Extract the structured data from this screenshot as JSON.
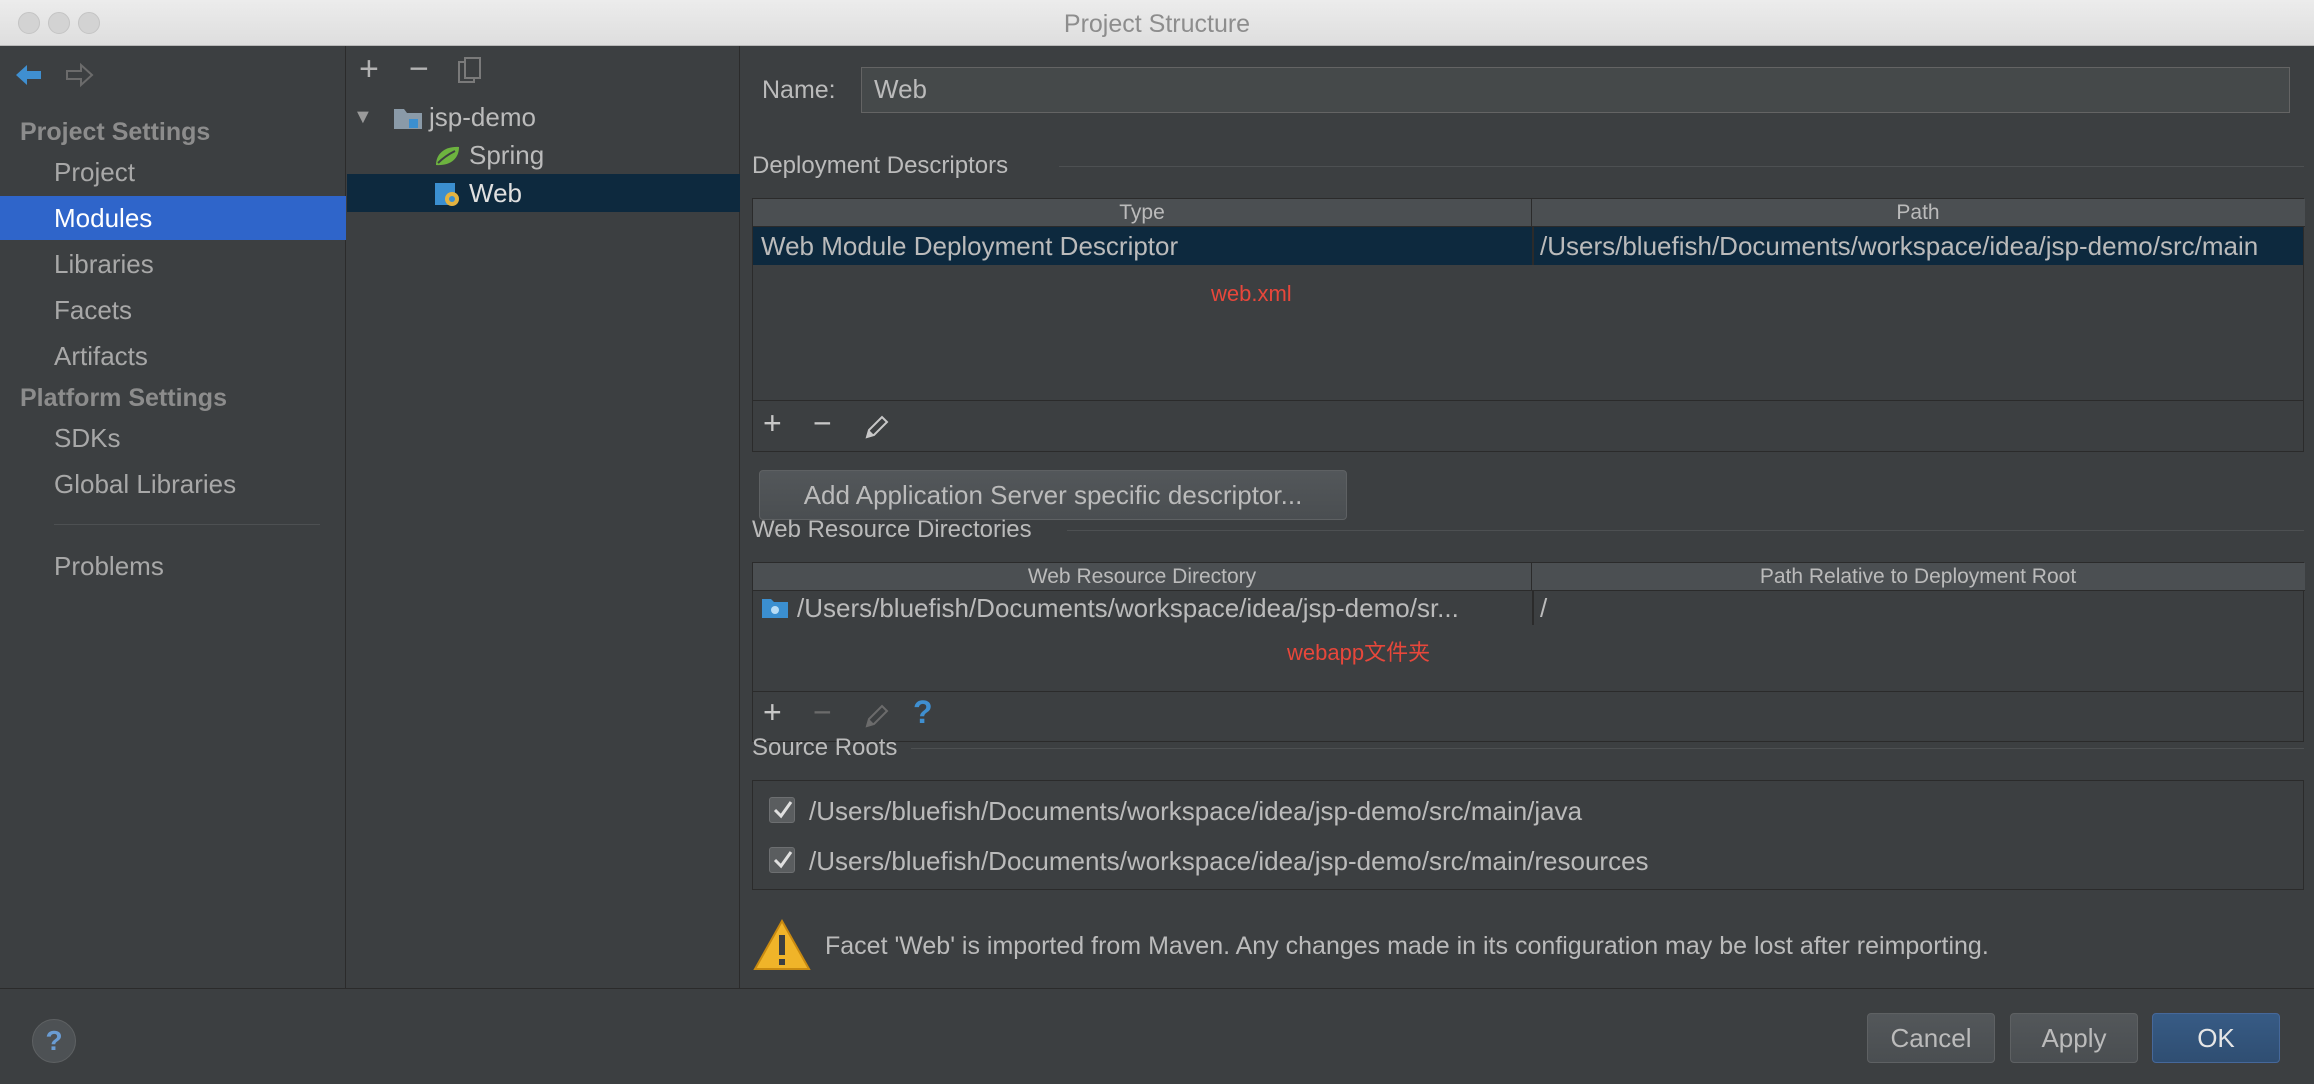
{
  "window": {
    "title": "Project Structure"
  },
  "nav": {
    "project_settings": "Project Settings",
    "project_items": [
      "Project",
      "Modules",
      "Libraries",
      "Facets",
      "Artifacts"
    ],
    "platform_settings": "Platform Settings",
    "platform_items": [
      "SDKs",
      "Global Libraries"
    ],
    "problems": "Problems",
    "selected": "Modules"
  },
  "tree": {
    "toolbar": {
      "add": "+",
      "remove": "−"
    },
    "nodes": [
      "jsp-demo",
      "Spring",
      "Web"
    ],
    "selected": "Web"
  },
  "form": {
    "name_label": "Name:",
    "name_value": "Web"
  },
  "deployment": {
    "title": "Deployment Descriptors",
    "columns": [
      "Type",
      "Path"
    ],
    "rows": [
      [
        "Web Module Deployment Descriptor",
        "/Users/bluefish/Documents/workspace/idea/jsp-demo/src/main"
      ]
    ],
    "annotation": "web.xml",
    "add_server_button": "Add Application Server specific descriptor..."
  },
  "web_resources": {
    "title": "Web Resource Directories",
    "columns": [
      "Web Resource Directory",
      "Path Relative to Deployment Root"
    ],
    "rows": [
      [
        "/Users/bluefish/Documents/workspace/idea/jsp-demo/sr...",
        "/"
      ]
    ],
    "annotation": "webapp文件夹",
    "help_glyph": "?"
  },
  "source_roots": {
    "title": "Source Roots",
    "items": [
      "/Users/bluefish/Documents/workspace/idea/jsp-demo/src/main/java",
      "/Users/bluefish/Documents/workspace/idea/jsp-demo/src/main/resources"
    ]
  },
  "warning": "Facet 'Web' is imported from Maven. Any changes made in its configuration may be lost after reimporting.",
  "footer": {
    "help": "?",
    "cancel": "Cancel",
    "apply": "Apply",
    "ok": "OK"
  },
  "colors": {
    "selection": "#2f65ca",
    "tree_selection": "#0d293e",
    "annotation": "#e7473b",
    "background": "#3c3f41"
  }
}
